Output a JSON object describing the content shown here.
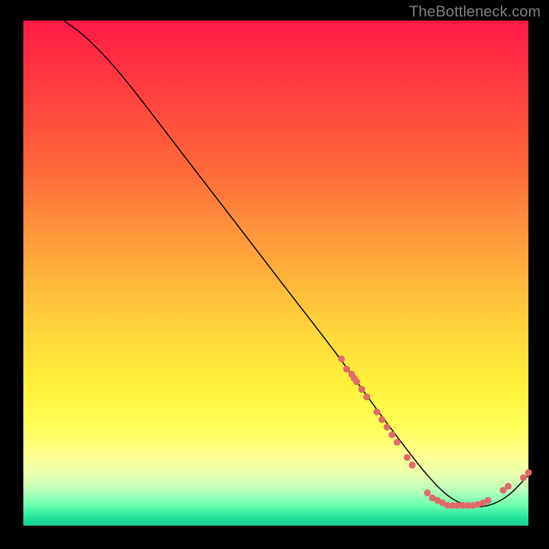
{
  "watermark": "TheBottleneck.com",
  "chart_data": {
    "type": "line",
    "title": "",
    "xlabel": "",
    "ylabel": "",
    "xlim": [
      0,
      100
    ],
    "ylim": [
      0,
      100
    ],
    "grid": false,
    "legend": false,
    "curve": {
      "x": [
        8,
        12,
        17,
        22,
        32,
        42,
        52,
        62,
        70,
        76,
        80,
        84,
        88,
        92,
        96,
        100
      ],
      "y": [
        100,
        97,
        92,
        86,
        73,
        60,
        47,
        34,
        23,
        15,
        10,
        6,
        4,
        4,
        6,
        10
      ]
    },
    "curve_color": "#000000",
    "markers": [
      {
        "x": 63,
        "y": 33
      },
      {
        "x": 64,
        "y": 31
      },
      {
        "x": 65,
        "y": 30
      },
      {
        "x": 65.5,
        "y": 29.2
      },
      {
        "x": 66,
        "y": 28.5
      },
      {
        "x": 67,
        "y": 27
      },
      {
        "x": 68,
        "y": 25.5
      },
      {
        "x": 70,
        "y": 22.5
      },
      {
        "x": 71,
        "y": 21
      },
      {
        "x": 72,
        "y": 19.5
      },
      {
        "x": 73,
        "y": 18
      },
      {
        "x": 74,
        "y": 16.5
      },
      {
        "x": 76,
        "y": 13.5
      },
      {
        "x": 77,
        "y": 12
      },
      {
        "x": 80,
        "y": 6.5
      },
      {
        "x": 81,
        "y": 5.5
      },
      {
        "x": 82,
        "y": 5
      },
      {
        "x": 83,
        "y": 4.5
      },
      {
        "x": 84,
        "y": 4
      },
      {
        "x": 85,
        "y": 4
      },
      {
        "x": 86,
        "y": 4
      },
      {
        "x": 87,
        "y": 4
      },
      {
        "x": 88,
        "y": 4
      },
      {
        "x": 89,
        "y": 4
      },
      {
        "x": 90,
        "y": 4.2
      },
      {
        "x": 91,
        "y": 4.5
      },
      {
        "x": 92,
        "y": 5
      },
      {
        "x": 95,
        "y": 7
      },
      {
        "x": 96,
        "y": 7.8
      },
      {
        "x": 99,
        "y": 9.5
      },
      {
        "x": 100,
        "y": 10.5
      }
    ],
    "marker_color": "#e06a6a",
    "marker_radius_px": 5
  }
}
